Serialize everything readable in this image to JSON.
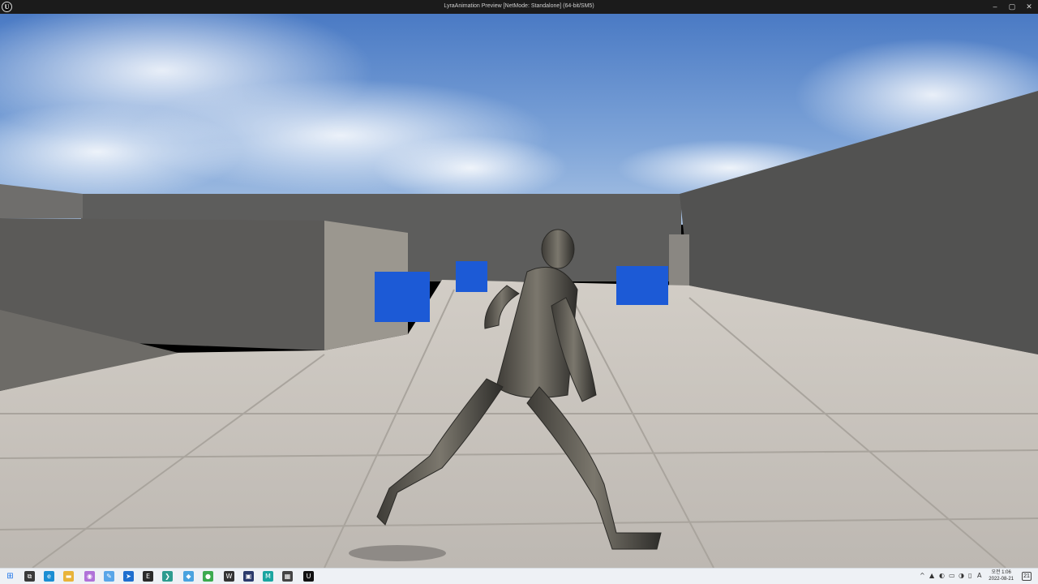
{
  "window": {
    "title": "LyraAnimation Preview [NetMode: Standalone]  (64-bit/SM5)",
    "logo_text": "U",
    "controls": {
      "minimize": "–",
      "maximize": "▢",
      "close": "✕"
    }
  },
  "taskbar": {
    "start_icon": "windows-start-icon",
    "apps": [
      {
        "name": "task-view-icon",
        "glyph": "⧉",
        "color": "#3a3a3a"
      },
      {
        "name": "edge-icon",
        "glyph": "e",
        "color": "#1b8ed3"
      },
      {
        "name": "file-explorer-icon",
        "glyph": "▬",
        "color": "#e8b339"
      },
      {
        "name": "store-icon",
        "glyph": "◉",
        "color": "#b072d8"
      },
      {
        "name": "paint-icon",
        "glyph": "✎",
        "color": "#5aa6e8"
      },
      {
        "name": "shell-icon",
        "glyph": "➤",
        "color": "#1f6fcf"
      },
      {
        "name": "epic-games-icon",
        "glyph": "E",
        "color": "#2a2a2a"
      },
      {
        "name": "terminal-icon",
        "glyph": "❯",
        "color": "#2d9c8f"
      },
      {
        "name": "photos-icon",
        "glyph": "◆",
        "color": "#4aa3df"
      },
      {
        "name": "chat-icon",
        "glyph": "●",
        "color": "#3caa4f"
      },
      {
        "name": "word-icon",
        "glyph": "W",
        "color": "#333333"
      },
      {
        "name": "media-icon",
        "glyph": "▣",
        "color": "#2b3a6b"
      },
      {
        "name": "maya-icon",
        "glyph": "M",
        "color": "#1aa5a0"
      },
      {
        "name": "substance-icon",
        "glyph": "▦",
        "color": "#444444"
      },
      {
        "name": "unreal-engine-icon",
        "glyph": "U",
        "color": "#111111"
      }
    ],
    "tray": {
      "chevron": "^",
      "icons": [
        "▲",
        "◐",
        "▭",
        "◑",
        "▯",
        "A"
      ],
      "time": "오전 1:06",
      "date": "2022-08-21",
      "notification_count": "21"
    }
  }
}
